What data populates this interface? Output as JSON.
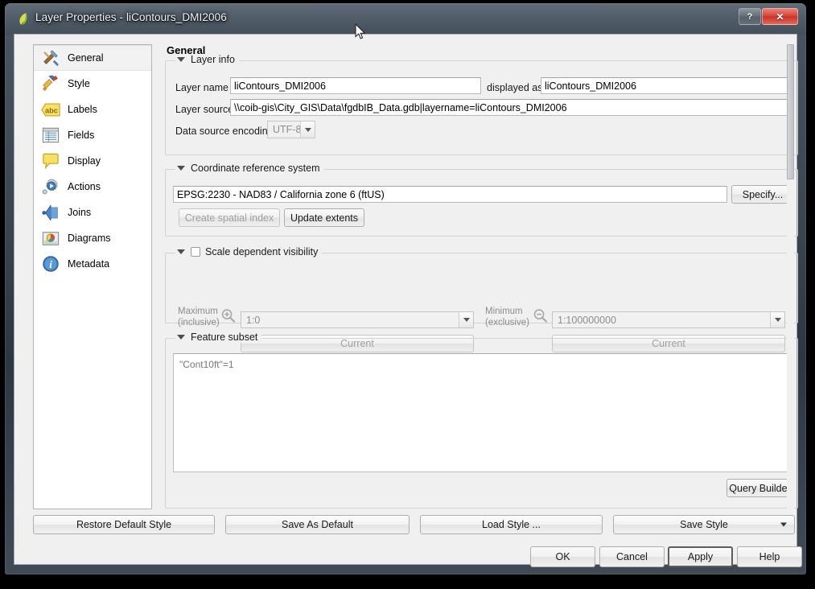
{
  "window": {
    "title": "Layer Properties - liContours_DMI2006",
    "app_icon": "qgis-leaf-icon",
    "help_button": "?",
    "close_button": "✕"
  },
  "sidebar": {
    "items": [
      {
        "label": "General",
        "icon": "hammer-wrench-icon",
        "selected": true
      },
      {
        "label": "Style",
        "icon": "paintbrush-icon",
        "selected": false
      },
      {
        "label": "Labels",
        "icon": "abc-label-icon",
        "selected": false
      },
      {
        "label": "Fields",
        "icon": "table-grid-icon",
        "selected": false
      },
      {
        "label": "Display",
        "icon": "speech-bubble-icon",
        "selected": false
      },
      {
        "label": "Actions",
        "icon": "gear-play-icon",
        "selected": false
      },
      {
        "label": "Joins",
        "icon": "left-arrow-join-icon",
        "selected": false
      },
      {
        "label": "Diagrams",
        "icon": "pie-chart-map-icon",
        "selected": false
      },
      {
        "label": "Metadata",
        "icon": "info-circle-icon",
        "selected": false
      }
    ]
  },
  "page": {
    "title": "General"
  },
  "layer_info": {
    "group_title": "Layer info",
    "layer_name_label": "Layer name",
    "layer_name_value": "liContours_DMI2006",
    "displayed_as_label": "displayed as",
    "displayed_as_value": "liContours_DMI2006",
    "layer_source_label": "Layer source",
    "layer_source_value": "\\\\coib-gis\\City_GIS\\Data\\fgdbIB_Data.gdb|layername=liContours_DMI2006",
    "encoding_label": "Data source encoding",
    "encoding_value": "UTF-8"
  },
  "crs": {
    "group_title": "Coordinate reference system",
    "value": "EPSG:2230 - NAD83 / California zone 6 (ftUS)",
    "specify_button": "Specify...",
    "create_spatial_index_button": "Create spatial index",
    "update_extents_button": "Update extents"
  },
  "scale_visibility": {
    "group_title": "Scale dependent visibility",
    "enabled": false,
    "maximum_label_line1": "Maximum",
    "maximum_label_line2": "(inclusive)",
    "maximum_icon": "zoom-in-icon",
    "maximum_value": "1:0",
    "maximum_current_button": "Current",
    "minimum_label_line1": "Minimum",
    "minimum_label_line2": "(exclusive)",
    "minimum_icon": "zoom-out-icon",
    "minimum_value": "1:100000000",
    "minimum_current_button": "Current"
  },
  "feature_subset": {
    "group_title": "Feature subset",
    "value": "\"Cont10ft\"=1",
    "query_builder_button": "Query Builder"
  },
  "style_bar": {
    "restore_default": "Restore Default Style",
    "save_as_default": "Save As Default",
    "load_style": "Load Style ...",
    "save_style": "Save Style"
  },
  "dialog_buttons": {
    "ok": "OK",
    "cancel": "Cancel",
    "apply": "Apply",
    "help": "Help",
    "focused": "Apply"
  },
  "colors": {
    "titlebar_dark": "#39444f",
    "close_red": "#d9453a",
    "client_bg": "#f0f0f0",
    "field_bg": "#ffffff",
    "group_border": "#d3d3d3",
    "disabled_text": "#8d8d8d"
  }
}
